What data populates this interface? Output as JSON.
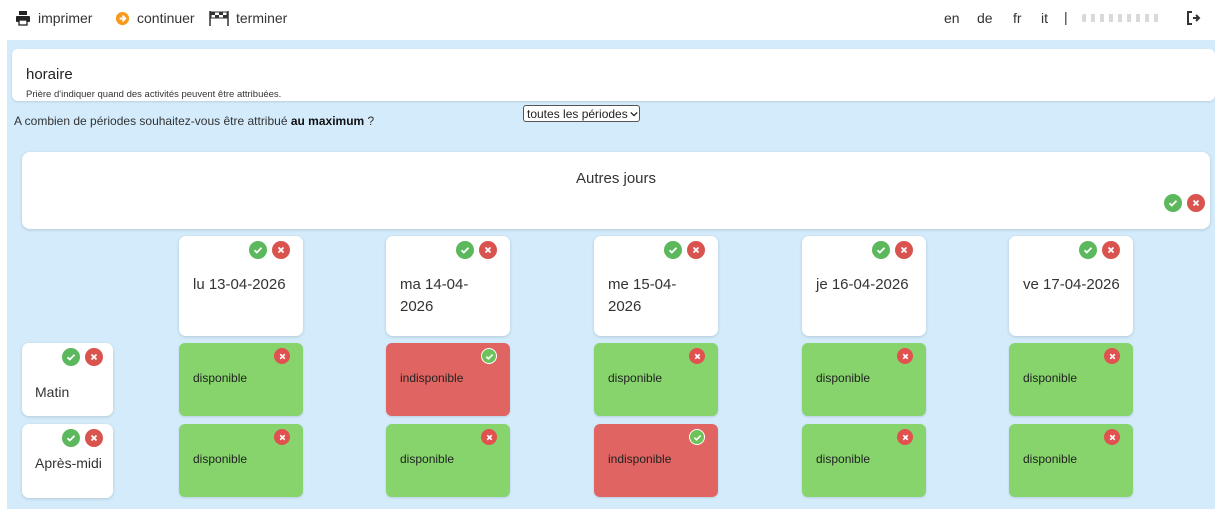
{
  "toolbar": {
    "print_label": "imprimer",
    "continue_label": "continuer",
    "finish_label": "terminer",
    "icons": {
      "print": "printer-icon",
      "continue": "arrow-right-circle-icon",
      "finish": "checkered-flag-icon",
      "logout": "logout-icon"
    },
    "languages": [
      "en",
      "de",
      "fr",
      "it"
    ],
    "separator": "|"
  },
  "header": {
    "title": "horaire",
    "subtitle": "Prière d'indiquer quand des activités peuvent être attribuées."
  },
  "question": {
    "text_before": "A combien de périodes souhaitez-vous être attribué ",
    "text_bold": "au maximum",
    "text_after": " ?",
    "select_value": "toutes les périodes"
  },
  "other_days": {
    "title": "Autres jours"
  },
  "days": [
    {
      "label": "lu 13-04-2026"
    },
    {
      "label": "ma 14-04-2026"
    },
    {
      "label": "me 15-04-2026"
    },
    {
      "label": "je 16-04-2026"
    },
    {
      "label": "ve 17-04-2026"
    }
  ],
  "periods": [
    {
      "label": "Matin"
    },
    {
      "label": "Après-midi"
    }
  ],
  "status_labels": {
    "available": "disponible",
    "unavailable": "indisponible"
  },
  "grid": [
    [
      "disponible",
      "indisponible",
      "disponible",
      "disponible",
      "disponible"
    ],
    [
      "disponible",
      "disponible",
      "indisponible",
      "disponible",
      "disponible"
    ]
  ],
  "colors": {
    "available": "#86d46b",
    "unavailable": "#e06461",
    "check": "#5cb85c",
    "cross": "#d9534f",
    "background": "#d3ebfb",
    "continue_icon": "#f59a1d"
  }
}
